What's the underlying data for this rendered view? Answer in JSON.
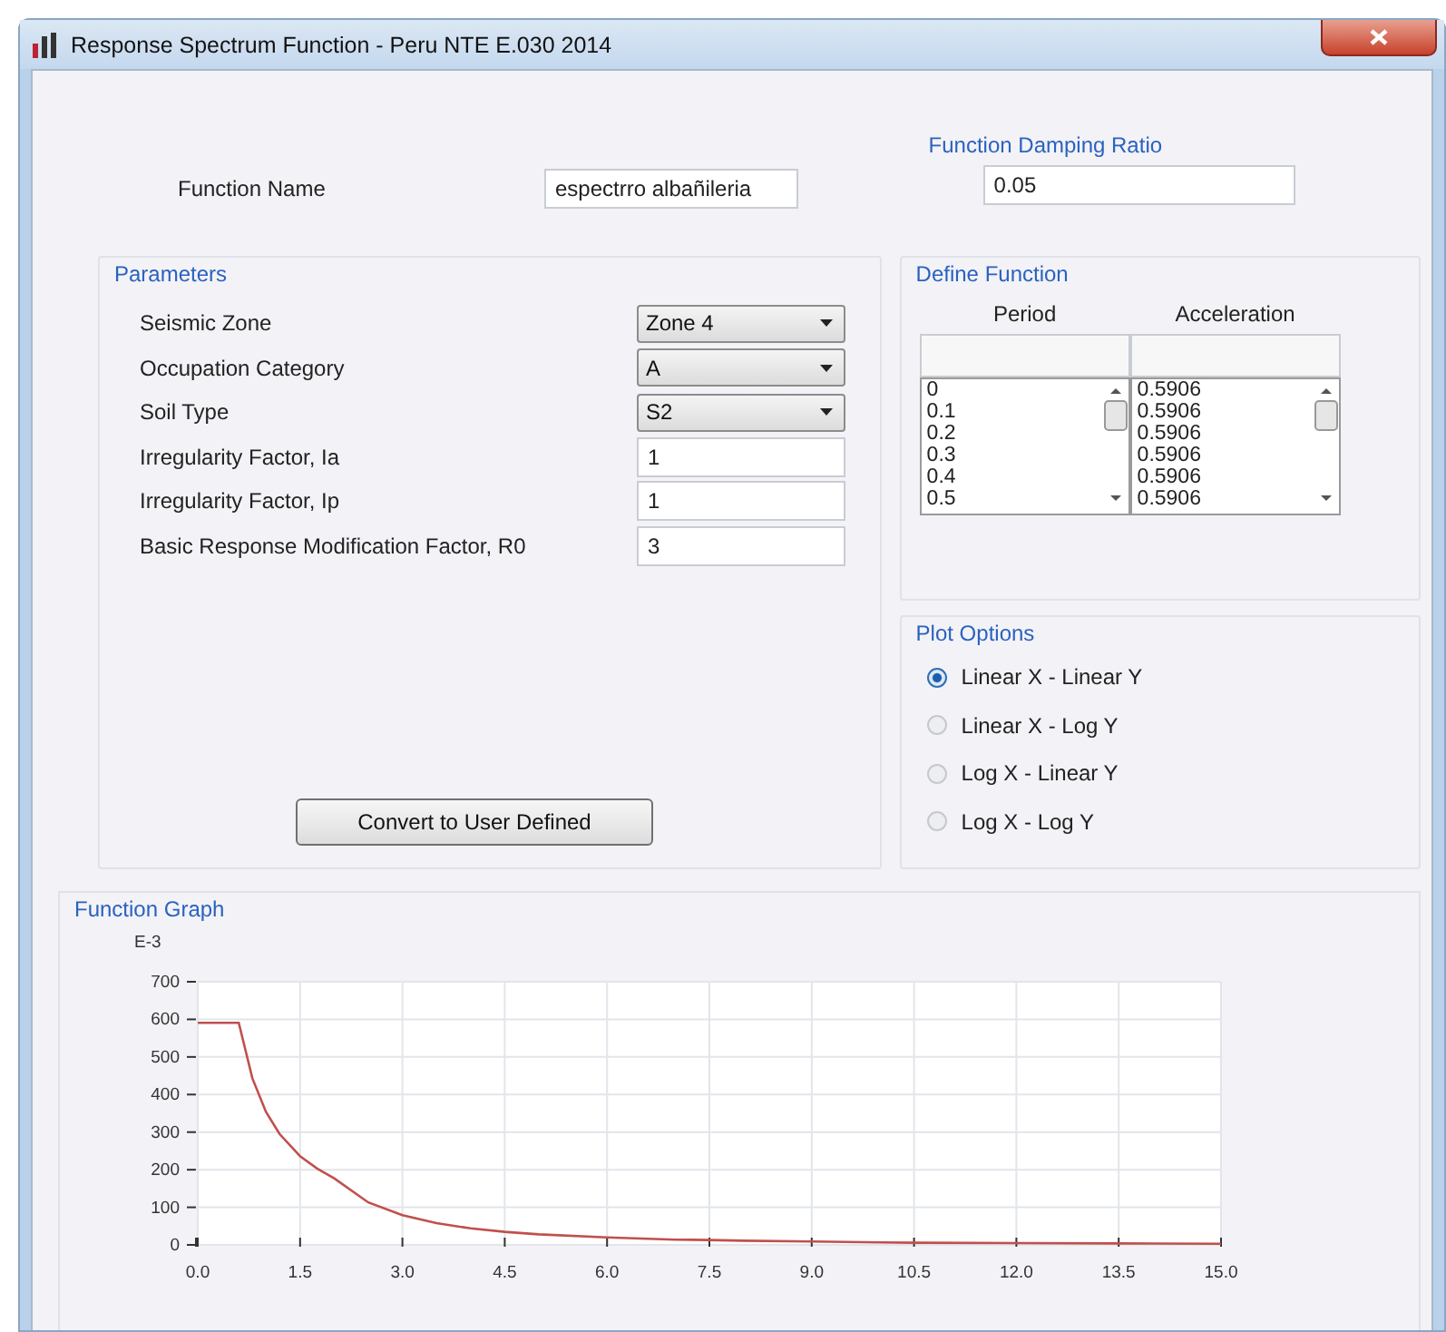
{
  "window": {
    "title": "Response Spectrum Function - Peru NTE E.030 2014"
  },
  "function_name": {
    "label": "Function Name",
    "value": "espectrro albañileria"
  },
  "damping": {
    "title": "Function Damping Ratio",
    "value": "0.05"
  },
  "parameters": {
    "title": "Parameters",
    "rows": [
      {
        "label": "Seismic Zone",
        "kind": "dropdown",
        "value": "Zone 4"
      },
      {
        "label": "Occupation Category",
        "kind": "dropdown",
        "value": "A"
      },
      {
        "label": "Soil Type",
        "kind": "dropdown",
        "value": "S2"
      },
      {
        "label": "Irregularity Factor, Ia",
        "kind": "text",
        "value": "1"
      },
      {
        "label": "Irregularity Factor, Ip",
        "kind": "text",
        "value": "1"
      },
      {
        "label": "Basic Response Modification Factor, R0",
        "kind": "text",
        "value": "3"
      }
    ]
  },
  "convert_button": "Convert to User Defined",
  "define_function": {
    "title": "Define Function",
    "columns": [
      "Period",
      "Acceleration"
    ],
    "period": [
      "0",
      "0.1",
      "0.2",
      "0.3",
      "0.4",
      "0.5"
    ],
    "acceleration": [
      "0.5906",
      "0.5906",
      "0.5906",
      "0.5906",
      "0.5906",
      "0.5906"
    ]
  },
  "plot_options": {
    "title": "Plot Options",
    "options": [
      {
        "label": "Linear X - Linear Y",
        "selected": true
      },
      {
        "label": "Linear X - Log Y",
        "selected": false
      },
      {
        "label": "Log X - Linear Y",
        "selected": false
      },
      {
        "label": "Log X - Log Y",
        "selected": false
      }
    ]
  },
  "function_graph": {
    "title": "Function Graph",
    "chart_data": {
      "type": "line",
      "ylabel": "E-3",
      "grid": true,
      "x": [
        0,
        0.6,
        0.8,
        1.0,
        1.2,
        1.5,
        1.75,
        2.0,
        2.5,
        3.0,
        3.5,
        4.0,
        4.5,
        5.0,
        6.0,
        7.0,
        7.5,
        8.0,
        9.0,
        10.0,
        10.5,
        12.0,
        13.5,
        15.0
      ],
      "series": [
        {
          "color": "#c0504d",
          "values": [
            591,
            591,
            443,
            354,
            295,
            236,
            203,
            177,
            113,
            79,
            58,
            44,
            35,
            28,
            20,
            14,
            13,
            11,
            9,
            7,
            6,
            5,
            4,
            3
          ]
        }
      ],
      "xlim": [
        0,
        15
      ],
      "ylim": [
        0,
        700
      ],
      "xticks": [
        {
          "value": 0,
          "label": "0.0"
        },
        {
          "value": 1.5,
          "label": "1.5"
        },
        {
          "value": 3,
          "label": "3.0"
        },
        {
          "value": 4.5,
          "label": "4.5"
        },
        {
          "value": 6,
          "label": "6.0"
        },
        {
          "value": 7.5,
          "label": "7.5"
        },
        {
          "value": 9,
          "label": "9.0"
        },
        {
          "value": 10.5,
          "label": "10.5"
        },
        {
          "value": 12,
          "label": "12.0"
        },
        {
          "value": 13.5,
          "label": "13.5"
        },
        {
          "value": 15,
          "label": "15.0"
        }
      ],
      "yticks": [
        0,
        100,
        200,
        300,
        400,
        500,
        600,
        700
      ]
    }
  }
}
